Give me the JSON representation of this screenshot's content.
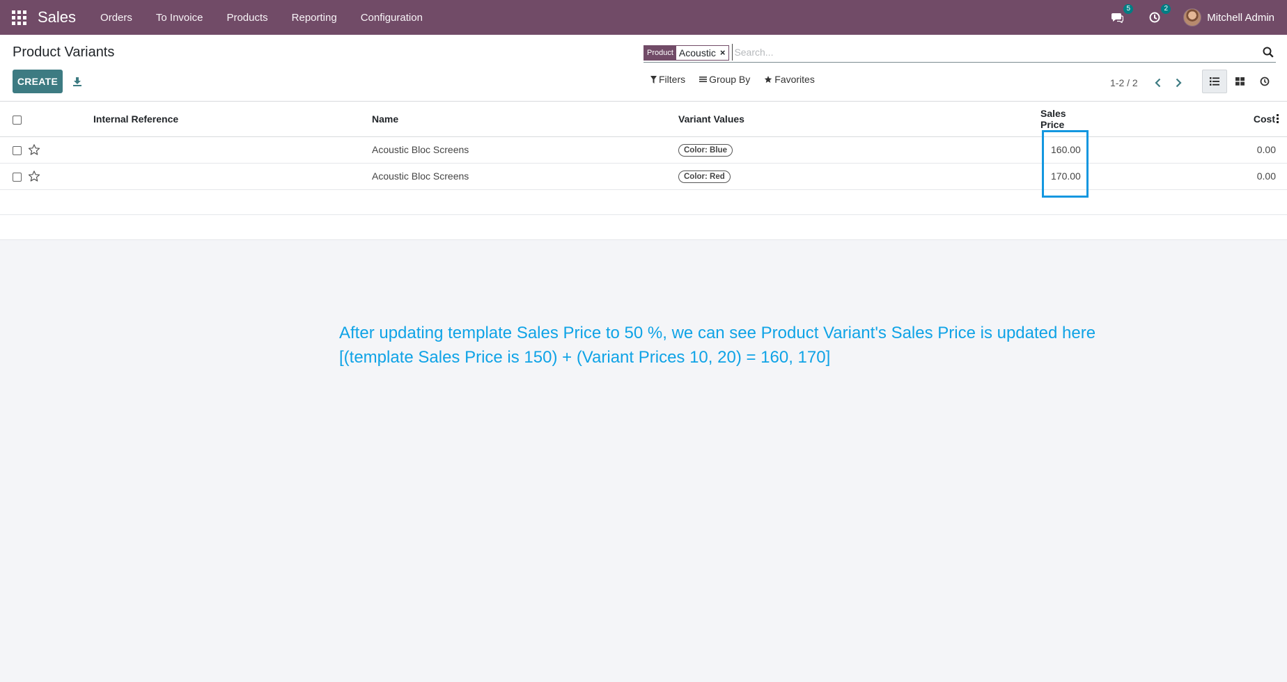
{
  "navbar": {
    "app_name": "Sales",
    "menu": [
      "Orders",
      "To Invoice",
      "Products",
      "Reporting",
      "Configuration"
    ],
    "messages_badge": "5",
    "activities_badge": "2",
    "user_name": "Mitchell Admin"
  },
  "control_panel": {
    "title": "Product Variants",
    "create_label": "CREATE",
    "search": {
      "facet_label": "Product",
      "facet_value": "Acoustic",
      "facet_remove": "×",
      "placeholder": "Search..."
    },
    "filters_label": "Filters",
    "group_by_label": "Group By",
    "favorites_label": "Favorites",
    "pager": "1-2 / 2"
  },
  "table": {
    "headers": {
      "internal_reference": "Internal Reference",
      "name": "Name",
      "variant_values": "Variant Values",
      "sales_price": "Sales Price",
      "cost": "Cost"
    },
    "rows": [
      {
        "internal_reference": "",
        "name": "Acoustic Bloc Screens",
        "variant": "Color: Blue",
        "sales_price": "160.00",
        "cost": "0.00"
      },
      {
        "internal_reference": "",
        "name": "Acoustic Bloc Screens",
        "variant": "Color: Red",
        "sales_price": "170.00",
        "cost": "0.00"
      }
    ]
  },
  "annotation": {
    "line1": "After updating template Sales Price to 50 %, we can see Product Variant's Sales Price is updated here",
    "line2": "[(template Sales Price is 150) + (Variant Prices 10, 20) = 160, 170]"
  },
  "colors": {
    "navbar": "#714b67",
    "primary_button": "#3d7b82",
    "annotation": "#0fa3e6",
    "highlight": "#1397e0"
  }
}
